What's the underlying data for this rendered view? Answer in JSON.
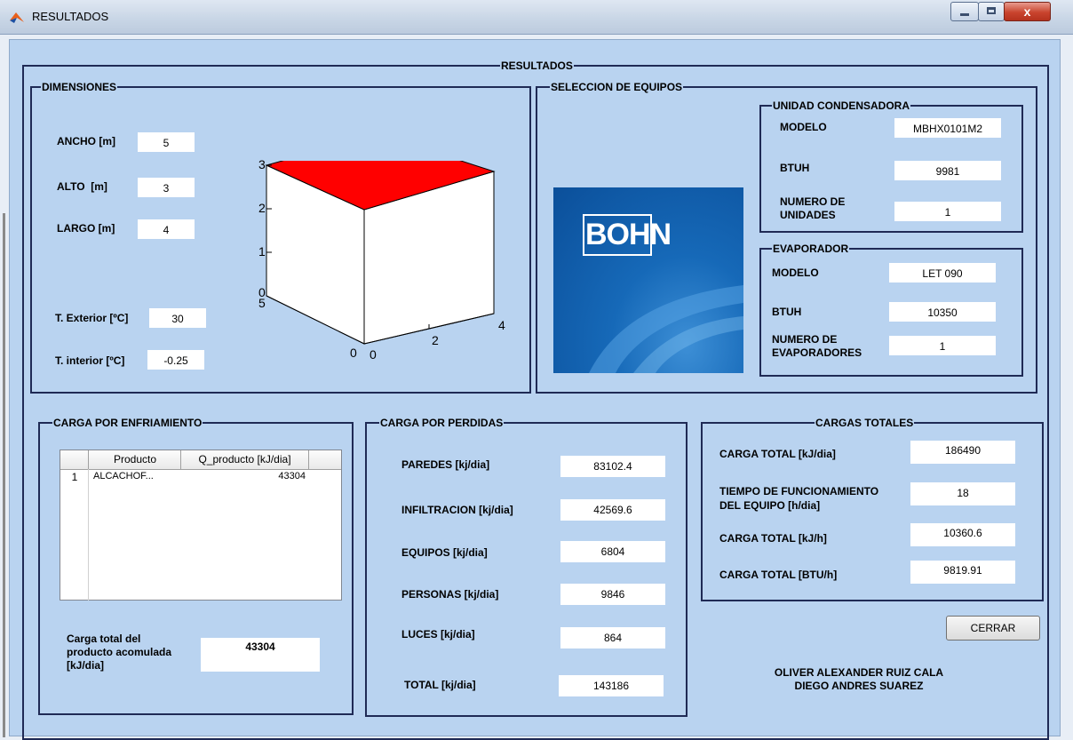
{
  "window": {
    "title": "RESULTADOS",
    "close_glyph": "x"
  },
  "main_title": "RESULTADOS",
  "dimensiones": {
    "title": "DIMENSIONES",
    "ancho_label": "ANCHO [m]",
    "ancho_value": "5",
    "alto_label": "ALTO  [m]",
    "alto_value": "3",
    "largo_label": "LARGO [m]",
    "largo_value": "4",
    "texterior_label": "T. Exterior [ºC]",
    "texterior_value": "30",
    "tinterior_label": "T. interior [ºC]",
    "tinterior_value": "-0.25",
    "plot": {
      "z_ticks": [
        "3",
        "2",
        "1",
        "0"
      ],
      "x_ticks": [
        "5",
        "0"
      ],
      "y_ticks": [
        "0",
        "2",
        "4"
      ],
      "top_color": "#ff0000"
    }
  },
  "seleccion": {
    "title": "SELECCION DE EQUIPOS",
    "logo_text": "BOHN",
    "condensadora": {
      "title": "UNIDAD CONDENSADORA",
      "modelo_label": "MODELO",
      "modelo_value": "MBHX0101M2",
      "btuh_label": "BTUH",
      "btuh_value": "9981",
      "num_label_1": "NUMERO DE",
      "num_label_2": "UNIDADES",
      "num_value": "1"
    },
    "evaporador": {
      "title": "EVAPORADOR",
      "modelo_label": "MODELO",
      "modelo_value": "LET 090",
      "btuh_label": "BTUH",
      "btuh_value": "10350",
      "num_label_1": "NUMERO DE",
      "num_label_2": "EVAPORADORES",
      "num_value": "1"
    }
  },
  "enfriamiento": {
    "title": "CARGA POR ENFRIAMIENTO",
    "table": {
      "columns": [
        "Producto",
        "Q_producto [kJ/dia]"
      ],
      "rows": [
        {
          "index": "1",
          "producto": "ALCACHOF...",
          "q": "43304"
        }
      ]
    },
    "total_label_1": "Carga total del",
    "total_label_2": "producto acomulada",
    "total_label_3": "[kJ/dia]",
    "total_value": "43304"
  },
  "perdidas": {
    "title": "CARGA POR PERDIDAS",
    "paredes_label": "PAREDES [kj/dia]",
    "paredes_value": "83102.4",
    "infiltracion_label": "INFILTRACION [kj/dia]",
    "infiltracion_value": "42569.6",
    "equipos_label": "EQUIPOS [kj/dia]",
    "equipos_value": "6804",
    "personas_label": "PERSONAS [kj/dia]",
    "personas_value": "9846",
    "luces_label": "LUCES [kj/dia]",
    "luces_value": "864",
    "total_label": "TOTAL [kj/dia]",
    "total_value": "143186"
  },
  "totales": {
    "title": "CARGAS TOTALES",
    "carga_kjdia_label": "CARGA TOTAL [kJ/dia]",
    "carga_kjdia_value": "186490",
    "tiempo_label_1": "TIEMPO DE FUNCIONAMIENTO",
    "tiempo_label_2": "DEL EQUIPO [h/dia]",
    "tiempo_value": "18",
    "carga_kjh_label": "CARGA TOTAL [kJ/h]",
    "carga_kjh_value": "10360.6",
    "carga_btuh_label": "CARGA TOTAL [BTU/h]",
    "carga_btuh_value": "9819.91"
  },
  "cerrar_label": "CERRAR",
  "authors": {
    "line1": "OLIVER ALEXANDER RUIZ CALA",
    "line2": "DIEGO ANDRES SUAREZ"
  }
}
